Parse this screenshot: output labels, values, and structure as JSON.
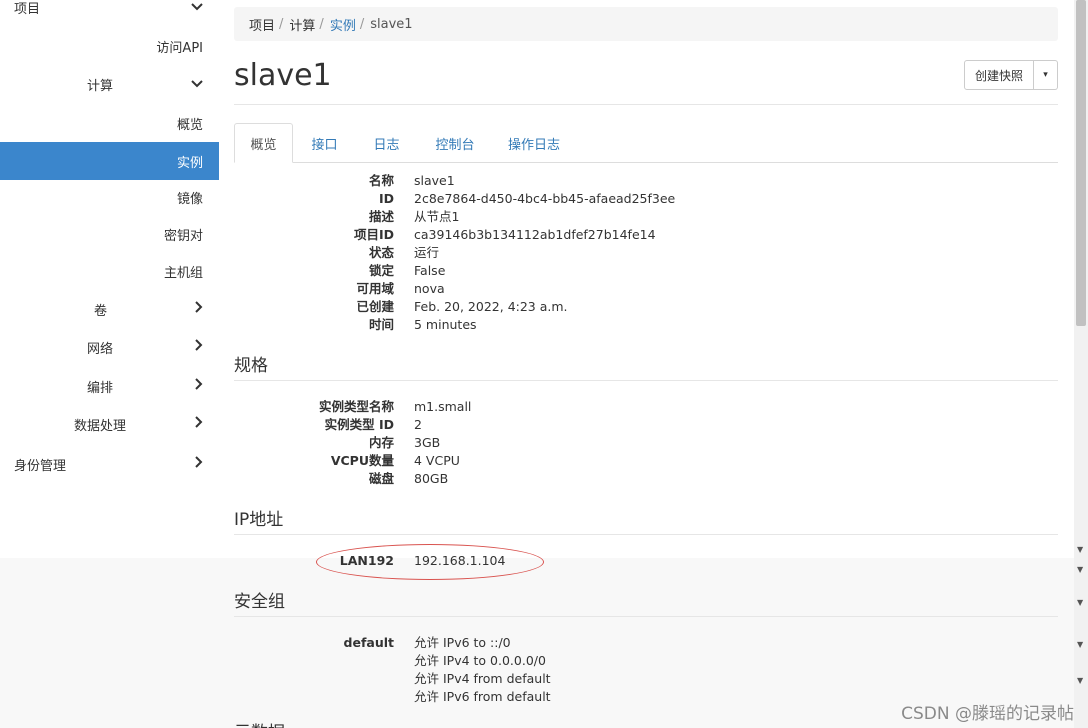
{
  "sidebar": {
    "items": [
      {
        "label": "项目",
        "chevron": "down"
      },
      {
        "label": "访问API"
      },
      {
        "label": "计算",
        "chevron": "down"
      },
      {
        "label": "概览"
      },
      {
        "label": "实例"
      },
      {
        "label": "镜像"
      },
      {
        "label": "密钥对"
      },
      {
        "label": "主机组"
      },
      {
        "label": "卷",
        "chevron": "right"
      },
      {
        "label": "网络",
        "chevron": "right"
      },
      {
        "label": "编排",
        "chevron": "right"
      },
      {
        "label": "数据处理",
        "chevron": "right"
      },
      {
        "label": "身份管理",
        "chevron": "right"
      }
    ],
    "active_item": "实例",
    "active_color": "#3b86cc"
  },
  "breadcrumb": [
    "项目",
    "计算",
    "实例",
    "slave1"
  ],
  "page_title": "slave1",
  "actions": {
    "create_snapshot": "创建快照",
    "caret": "▾"
  },
  "tabs": [
    "概览",
    "接口",
    "日志",
    "控制台",
    "操作日志"
  ],
  "active_tab": "概览",
  "overview": [
    {
      "label": "名称",
      "value": "slave1"
    },
    {
      "label": "ID",
      "value": "2c8e7864-d450-4bc4-bb45-afaead25f3ee"
    },
    {
      "label": "描述",
      "value": "从节点1"
    },
    {
      "label": "项目ID",
      "value": "ca39146b3b134112ab1dfef27b14fe14"
    },
    {
      "label": "状态",
      "value": "运行"
    },
    {
      "label": "锁定",
      "value": "False"
    },
    {
      "label": "可用域",
      "value": "nova"
    },
    {
      "label": "已创建",
      "value": "Feb. 20, 2022, 4:23 a.m."
    },
    {
      "label": "时间",
      "value": "5 minutes"
    }
  ],
  "specs": {
    "heading": "规格",
    "rows": [
      {
        "label": "实例类型名称",
        "value": "m1.small"
      },
      {
        "label": "实例类型 ID",
        "value": "2"
      },
      {
        "label": "内存",
        "value": "3GB"
      },
      {
        "label": "VCPU数量",
        "value": "4 VCPU"
      },
      {
        "label": "磁盘",
        "value": "80GB"
      }
    ]
  },
  "ip": {
    "heading": "IP地址",
    "rows": [
      {
        "label": "LAN192",
        "value": "192.168.1.104"
      }
    ],
    "highlight_color": "#d9534f"
  },
  "security": {
    "heading": "安全组",
    "group": "default",
    "rules": [
      "允许 IPv6 to ::/0",
      "允许 IPv4 to 0.0.0.0/0",
      "允许 IPv4 from default",
      "允许 IPv6 from default"
    ]
  },
  "next_heading_partial": "元数据",
  "watermark": "CSDN @滕瑶的记录帖",
  "colors": {
    "link": "#337ab7",
    "accent": "#3b86cc"
  }
}
